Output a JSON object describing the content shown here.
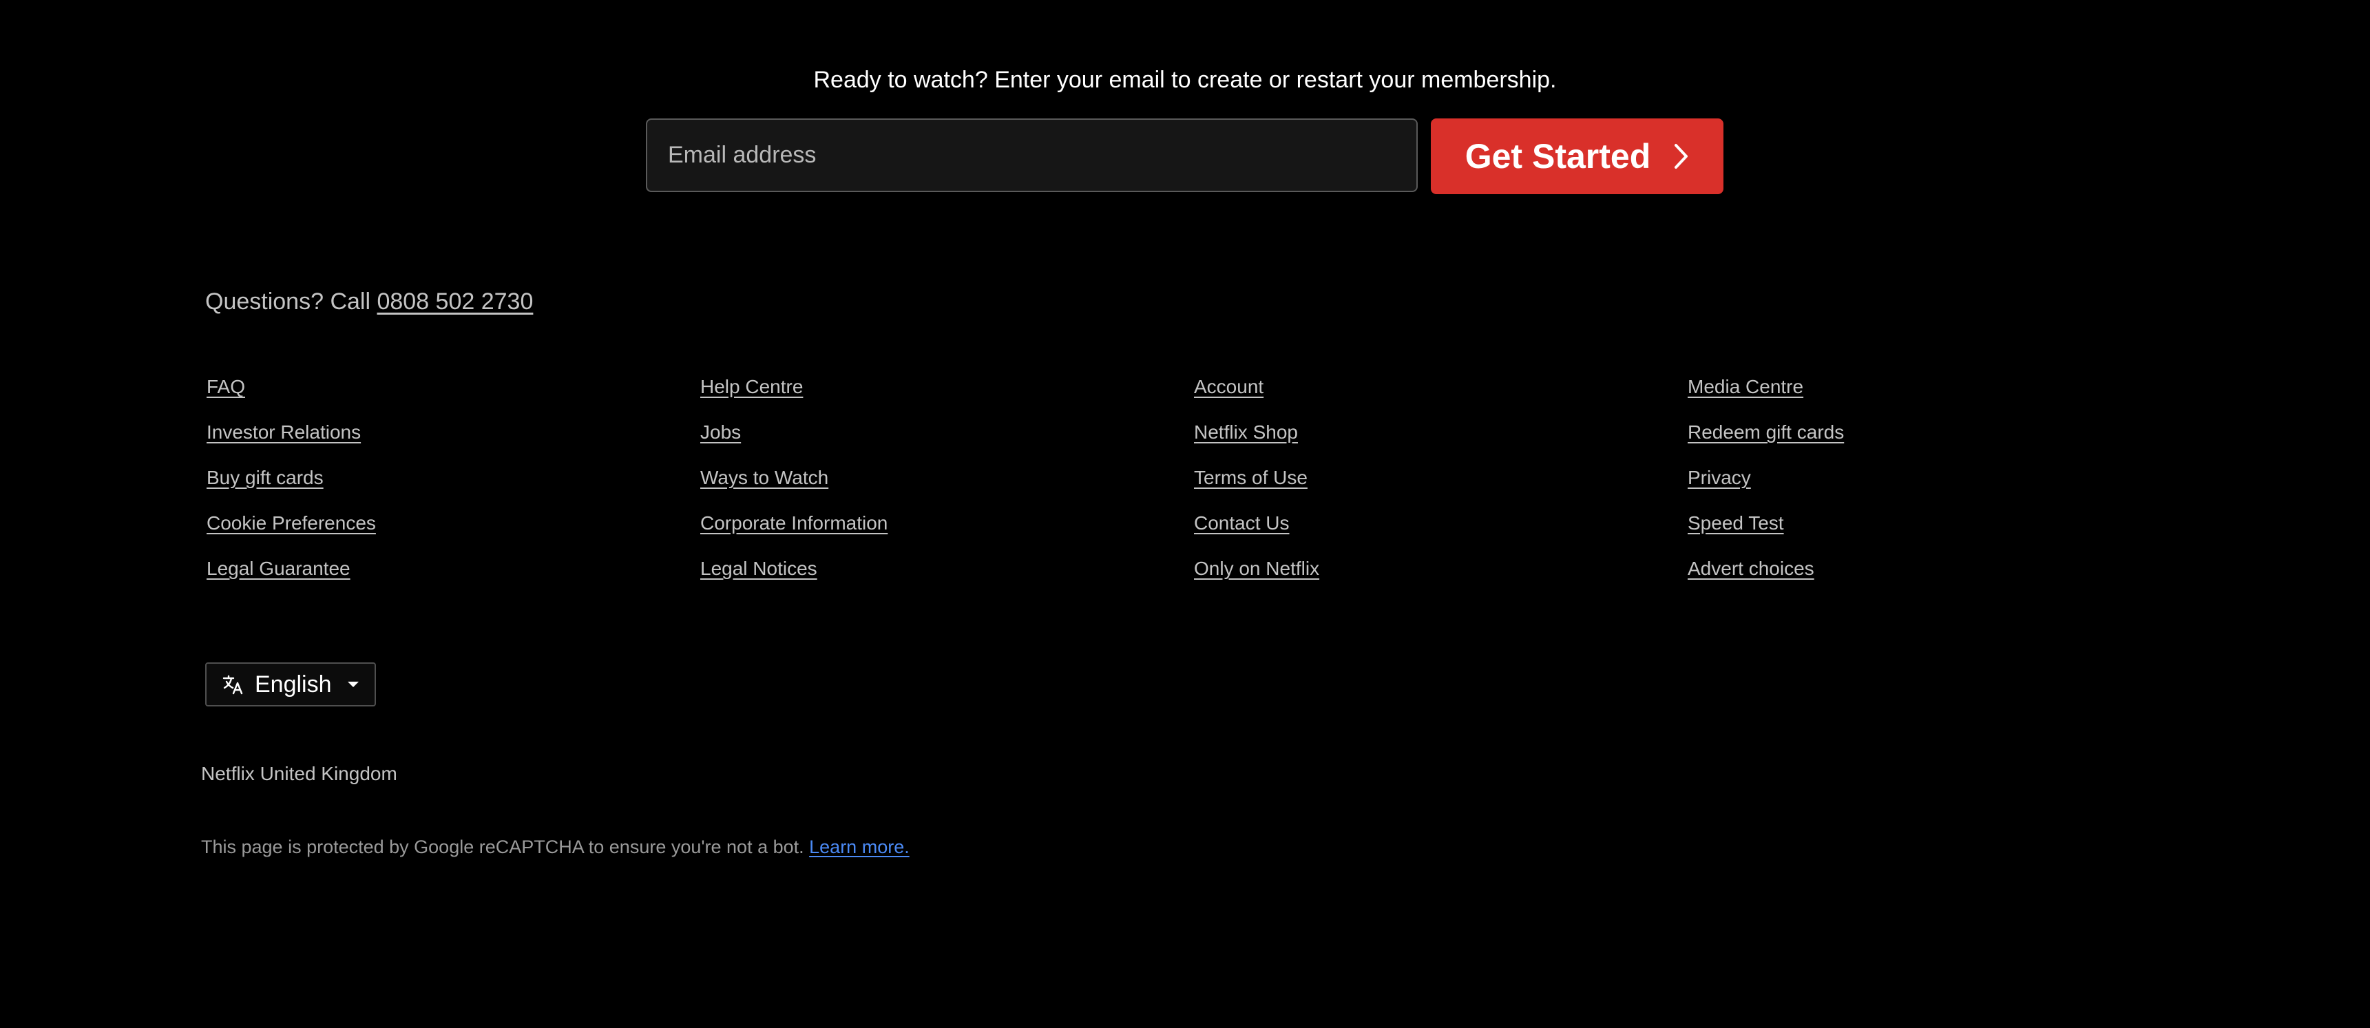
{
  "hero": {
    "prompt": "Ready to watch? Enter your email to create or restart your membership."
  },
  "email_form": {
    "placeholder": "Email address",
    "button_label": "Get Started"
  },
  "contact": {
    "prefix": "Questions? Call ",
    "phone": "0808 502 2730"
  },
  "footer": {
    "links": [
      "FAQ",
      "Help Centre",
      "Account",
      "Media Centre",
      "Investor Relations",
      "Jobs",
      "Netflix Shop",
      "Redeem gift cards",
      "Buy gift cards",
      "Ways to Watch",
      "Terms of Use",
      "Privacy",
      "Cookie Preferences",
      "Corporate Information",
      "Contact Us",
      "Speed Test",
      "Legal Guarantee",
      "Legal Notices",
      "Only on Netflix",
      "Advert choices"
    ]
  },
  "language": {
    "selected": "English",
    "icon": "language-icon"
  },
  "country": "Netflix United Kingdom",
  "recaptcha": {
    "text": "This page is protected by Google reCAPTCHA to ensure you're not a bot. ",
    "link": "Learn more."
  },
  "colors": {
    "background": "#000000",
    "cta": "#d9302a",
    "link_muted": "#c4c4c4",
    "learn_more": "#4b8af5"
  }
}
